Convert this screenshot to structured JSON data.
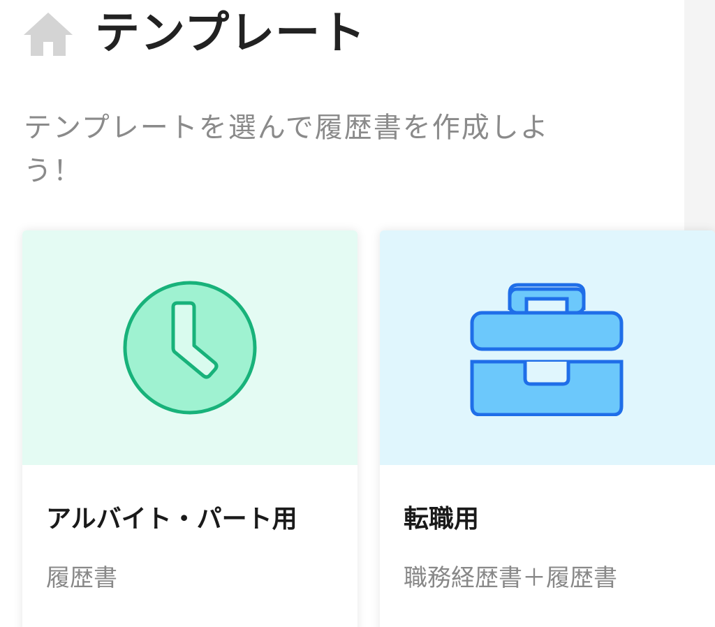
{
  "header": {
    "icon": "home-icon",
    "title": "テンプレート"
  },
  "subtitle": "テンプレートを選んで履歴書を作成しよう！",
  "cards": [
    {
      "icon": "clock-icon",
      "title": "アルバイト・パート用",
      "description": "履歴書",
      "accent_bg": "#e4fbf3",
      "icon_color": "#18b27a"
    },
    {
      "icon": "toolbox-icon",
      "title": "転職用",
      "description": "職務経歴書＋履歴書",
      "accent_bg": "#e0f6fd",
      "icon_color": "#1f6ee8"
    }
  ]
}
